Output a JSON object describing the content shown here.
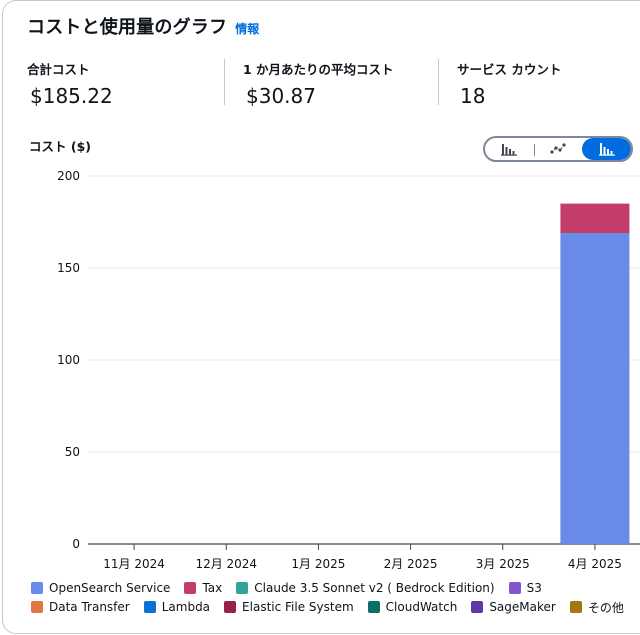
{
  "header": {
    "title": "コストと使用量のグラフ",
    "info_link": "情報"
  },
  "kpis": [
    {
      "label": "合計コスト",
      "value": "$185.22"
    },
    {
      "label": "1 か月あたりの平均コスト",
      "value": "$30.87"
    },
    {
      "label": "サービス カウント",
      "value": "18"
    }
  ],
  "chart_title": "コスト ($)",
  "chart_type_toggle": {
    "options": [
      "bar-chart-icon",
      "line-chart-icon",
      "stacked-bar-chart-icon"
    ],
    "selected": "stacked-bar-chart-icon",
    "accent": "#006ce0"
  },
  "chart_data": {
    "type": "bar",
    "stacked": true,
    "categories": [
      "11月 2024",
      "12月 2024",
      "1月 2025",
      "2月 2025",
      "3月 2025",
      "4月 2025"
    ],
    "ylim": [
      0,
      200
    ],
    "yticks": [
      0,
      50,
      100,
      150,
      200
    ],
    "grid": true,
    "legend_position": "bottom",
    "series": [
      {
        "name": "OpenSearch Service",
        "color": "#688ae8",
        "values": [
          0,
          0,
          0,
          0,
          0,
          169
        ]
      },
      {
        "name": "Tax",
        "color": "#c33d69",
        "values": [
          0,
          0,
          0,
          0,
          0,
          16
        ]
      },
      {
        "name": "Claude 3.5 Sonnet v2 ( Bedrock Edition)",
        "color": "#2ea597",
        "values": [
          0,
          0,
          0,
          0,
          0,
          0
        ]
      },
      {
        "name": "S3",
        "color": "#8456ce",
        "values": [
          0,
          0,
          0,
          0,
          0,
          0
        ]
      },
      {
        "name": "Data Transfer",
        "color": "#e07941",
        "values": [
          0,
          0,
          0,
          0,
          0,
          0
        ]
      },
      {
        "name": "Lambda",
        "color": "#3759ce",
        "values": [
          0,
          0,
          0,
          0,
          0,
          0
        ]
      },
      {
        "name": "Elastic File System",
        "color": "#962249",
        "values": [
          0,
          0,
          0,
          0,
          0,
          0
        ]
      },
      {
        "name": "CloudWatch",
        "color": "#096f64",
        "values": [
          0,
          0,
          0,
          0,
          0,
          0
        ]
      },
      {
        "name": "SageMaker",
        "color": "#6237a7",
        "values": [
          0,
          0,
          0,
          0,
          0,
          0
        ]
      },
      {
        "name": "その他",
        "color": "#a3780f",
        "values": [
          0,
          0,
          0,
          0,
          0,
          0
        ]
      }
    ]
  },
  "legend_colors": [
    "#688ae8",
    "#c33d69",
    "#2ea597",
    "#8456ce",
    "#e07941",
    "#0972d3",
    "#962249",
    "#096f64",
    "#6237a7",
    "#a3780f"
  ]
}
